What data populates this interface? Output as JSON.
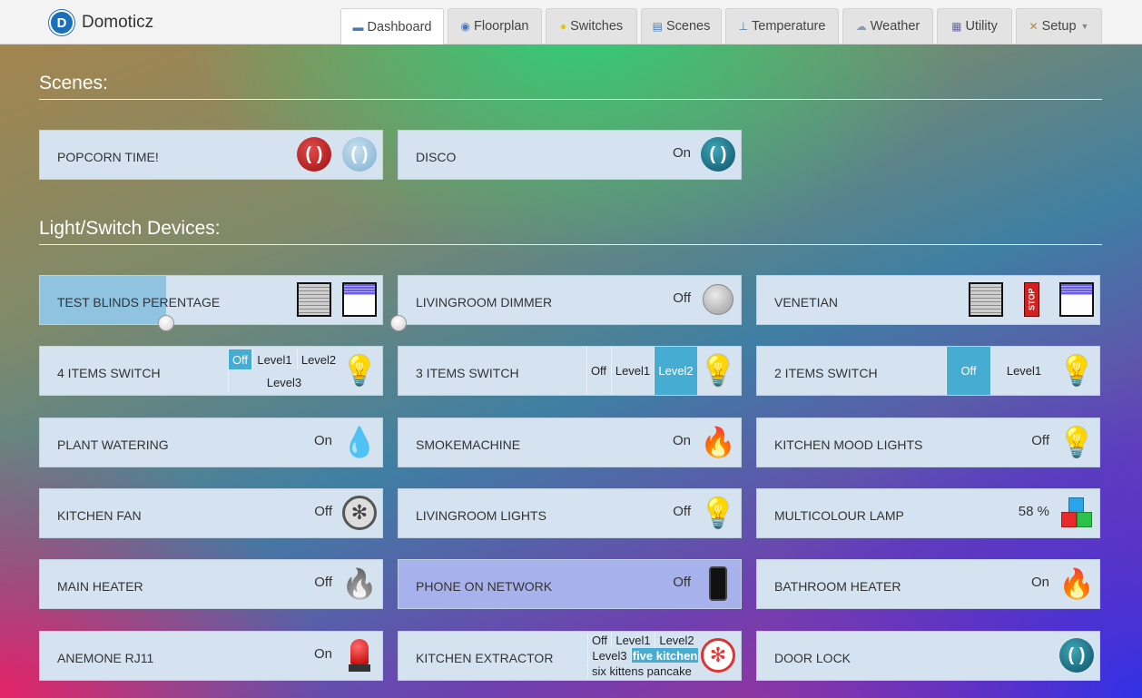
{
  "brand": {
    "name": "Domoticz",
    "logo_letter": "D"
  },
  "nav": [
    {
      "label": "Dashboard",
      "icon": "dashboard-icon",
      "active": true
    },
    {
      "label": "Floorplan",
      "icon": "floorplan-icon"
    },
    {
      "label": "Switches",
      "icon": "bulb-icon"
    },
    {
      "label": "Scenes",
      "icon": "clapper-icon"
    },
    {
      "label": "Temperature",
      "icon": "thermometer-icon"
    },
    {
      "label": "Weather",
      "icon": "cloud-icon"
    },
    {
      "label": "Utility",
      "icon": "utility-icon"
    },
    {
      "label": "Setup",
      "icon": "tools-icon",
      "dropdown": true
    }
  ],
  "sections": {
    "scenes": "Scenes:",
    "devices": "Light/Switch Devices:"
  },
  "scenes": [
    {
      "name": "Popcorn Time!",
      "status": ""
    },
    {
      "name": "Disco",
      "status": "On"
    }
  ],
  "devices": {
    "test_blinds": {
      "name": "Test Blinds Perentage",
      "level_percent": 37
    },
    "livingroom_dimmer": {
      "name": "Livingroom Dimmer",
      "status": "Off",
      "level_percent": 0
    },
    "venetian": {
      "name": "Venetian",
      "stop_label": "STOP"
    },
    "four_items": {
      "name": "4 Items Switch",
      "levels": [
        "Off",
        "Level1",
        "Level2",
        "Level3"
      ],
      "selected": "Off"
    },
    "three_items": {
      "name": "3 Items Switch",
      "levels": [
        "Off",
        "Level1",
        "Level2"
      ],
      "selected": "Level2"
    },
    "two_items": {
      "name": "2 Items Switch",
      "levels": [
        "Off",
        "Level1"
      ],
      "selected": "Off"
    },
    "plant_watering": {
      "name": "Plant Watering",
      "status": "On"
    },
    "smokemachine": {
      "name": "Smokemachine",
      "status": "On"
    },
    "kitchen_mood": {
      "name": "Kitchen Mood Lights",
      "status": "Off"
    },
    "kitchen_fan": {
      "name": "Kitchen Fan",
      "status": "Off"
    },
    "livingroom_lights": {
      "name": "Livingroom Lights",
      "status": "Off"
    },
    "multicolour": {
      "name": "Multicolour Lamp",
      "status": "58 %"
    },
    "main_heater": {
      "name": "Main Heater",
      "status": "Off"
    },
    "phone_network": {
      "name": "Phone On Network",
      "status": "Off"
    },
    "bathroom_heater": {
      "name": "Bathroom Heater",
      "status": "On"
    },
    "anemone": {
      "name": "Anemone RJ11",
      "status": "On"
    },
    "kitchen_extractor": {
      "name": "Kitchen Extractor",
      "levels": [
        "Off",
        "Level1",
        "Level2",
        "Level3",
        "five kitchen",
        "six kittens pancake"
      ],
      "selected": "five kitchen"
    },
    "door_lock": {
      "name": "Door Lock"
    }
  },
  "colors": {
    "card_bg": "#d5e3f1",
    "card_highlight": "#a7b2ec",
    "active_selector": "#47acd1",
    "slider_fill": "#8fc3e0"
  }
}
